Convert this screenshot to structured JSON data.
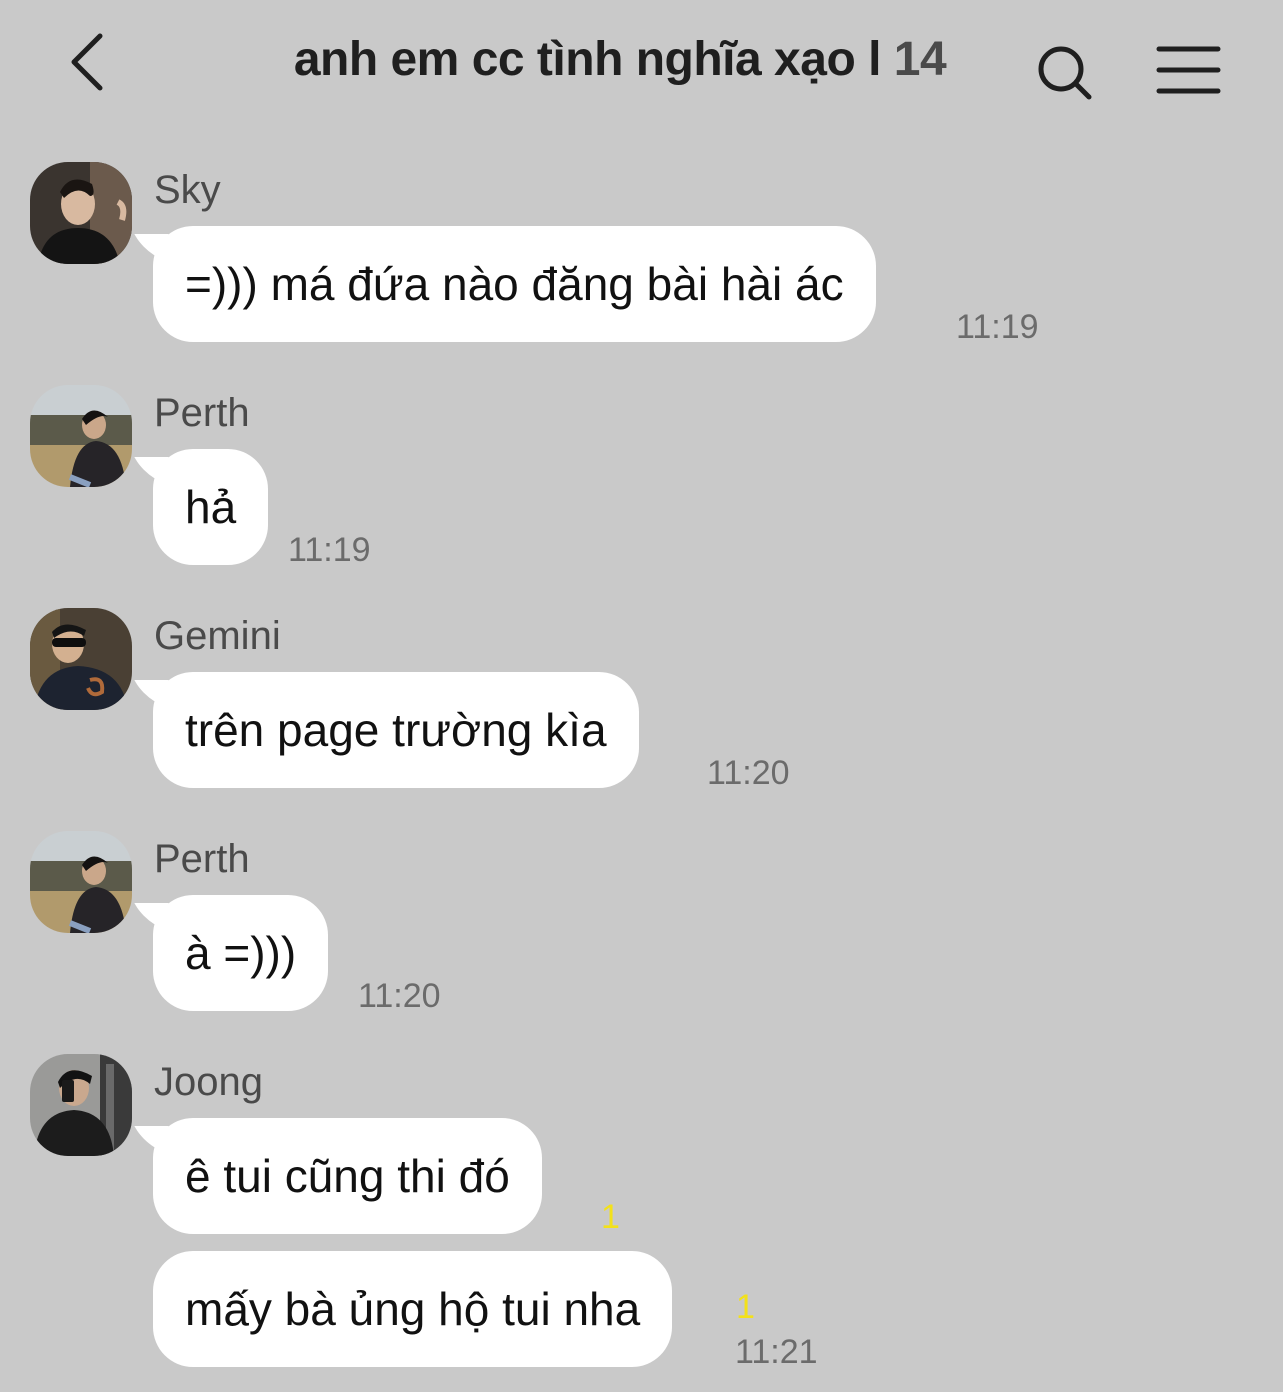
{
  "header": {
    "title": "anh em cc tình nghĩa xạo l",
    "member_count": "14"
  },
  "messages": [
    {
      "sender": "Sky",
      "text": "=))) má đứa nào đăng bài hài ác",
      "time": "11:19"
    },
    {
      "sender": "Perth",
      "text": "hả",
      "time": "11:19"
    },
    {
      "sender": "Gemini",
      "text": "trên page trường kìa",
      "time": "11:20"
    },
    {
      "sender": "Perth",
      "text": "à =)))",
      "time": "11:20"
    },
    {
      "sender": "Joong",
      "text": "ê tui cũng thi đó",
      "unread": "1"
    },
    {
      "sender": "Joong",
      "text": "mấy bà ủng hộ tui nha",
      "unread": "1",
      "time": "11:21"
    }
  ],
  "colors": {
    "background": "#c9c9c9",
    "bubble": "#ffffff",
    "unread_count": "#f3e11a"
  },
  "icons": [
    "chevron-left-icon",
    "search-icon",
    "hamburger-menu-icon"
  ]
}
